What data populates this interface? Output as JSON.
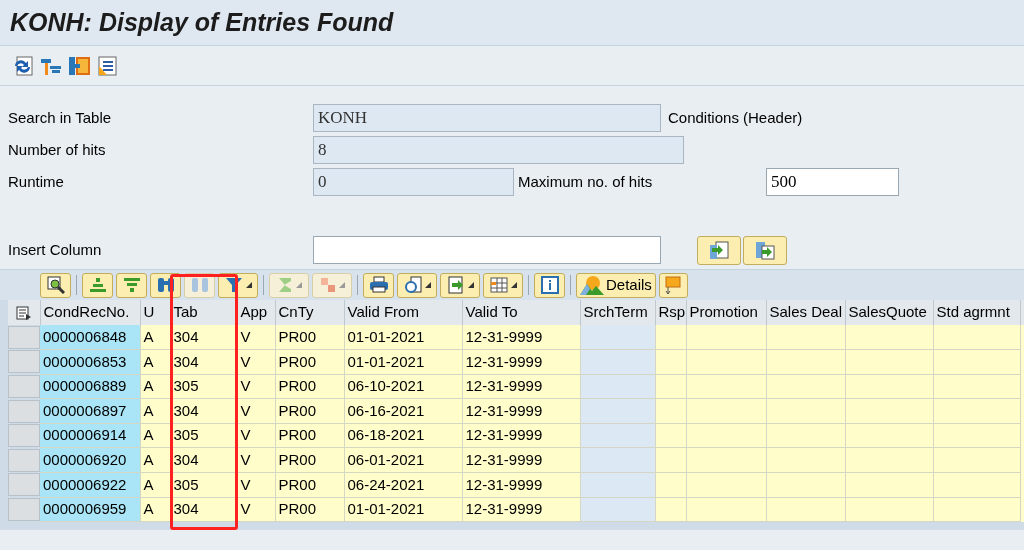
{
  "window": {
    "title": "KONH: Display of Entries Found"
  },
  "form": [
    {
      "label": "Search in Table",
      "value": "KONH",
      "note": "Conditions (Header)",
      "editable": false
    },
    {
      "label": "Number of hits",
      "value": "8",
      "editable": false
    },
    {
      "label": "Runtime",
      "value": "0",
      "editable": false,
      "extra_label": "Maximum no. of hits",
      "extra_value": "500"
    },
    {
      "label": "Insert Column",
      "editable": true
    }
  ],
  "grid_toolbar": {
    "details_label": "Details"
  },
  "table": {
    "columns": [
      {
        "label": "CondRecNo.",
        "kind": "key",
        "highlighted": false
      },
      {
        "label": "U",
        "kind": "data",
        "highlighted": false
      },
      {
        "label": "Tab",
        "kind": "data",
        "highlighted": true
      },
      {
        "label": "App",
        "kind": "data",
        "highlighted": false
      },
      {
        "label": "CnTy",
        "kind": "data",
        "highlighted": false
      },
      {
        "label": "Valid From",
        "kind": "data",
        "highlighted": false
      },
      {
        "label": "Valid To",
        "kind": "data",
        "highlighted": false
      },
      {
        "label": "SrchTerm",
        "kind": "plain",
        "highlighted": false
      },
      {
        "label": "Rsp",
        "kind": "data",
        "highlighted": false
      },
      {
        "label": "Promotion",
        "kind": "data",
        "highlighted": false
      },
      {
        "label": "Sales Deal",
        "kind": "data",
        "highlighted": false
      },
      {
        "label": "SalesQuote",
        "kind": "data",
        "highlighted": false
      },
      {
        "label": "Std agrmnt",
        "kind": "data",
        "highlighted": false
      }
    ],
    "rows": [
      [
        "0000006848",
        "A",
        "304",
        "V",
        "PR00",
        "01-01-2021",
        "12-31-9999"
      ],
      [
        "0000006853",
        "A",
        "304",
        "V",
        "PR00",
        "01-01-2021",
        "12-31-9999"
      ],
      [
        "0000006889",
        "A",
        "305",
        "V",
        "PR00",
        "06-10-2021",
        "12-31-9999"
      ],
      [
        "0000006897",
        "A",
        "304",
        "V",
        "PR00",
        "06-16-2021",
        "12-31-9999"
      ],
      [
        "0000006914",
        "A",
        "305",
        "V",
        "PR00",
        "06-18-2021",
        "12-31-9999"
      ],
      [
        "0000006920",
        "A",
        "304",
        "V",
        "PR00",
        "06-01-2021",
        "12-31-9999"
      ],
      [
        "0000006922",
        "A",
        "305",
        "V",
        "PR00",
        "06-24-2021",
        "12-31-9999"
      ],
      [
        "0000006959",
        "A",
        "304",
        "V",
        "PR00",
        "01-01-2021",
        "12-31-9999"
      ]
    ]
  }
}
